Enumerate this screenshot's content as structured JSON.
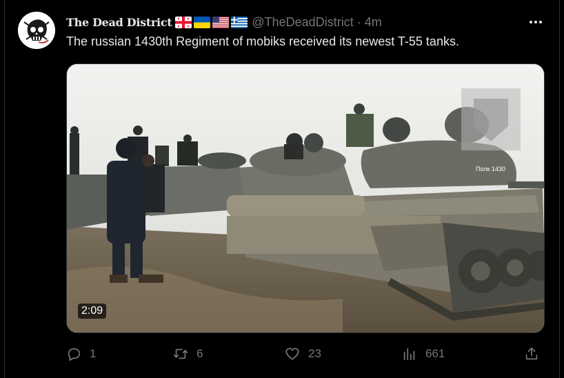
{
  "post": {
    "display_name": "The Dead District",
    "flags": [
      "georgia-flag-icon",
      "ukraine-flag-icon",
      "usa-flag-icon",
      "greece-flag-icon"
    ],
    "handle": "@TheDeadDistrict",
    "separator": "·",
    "time": "4m",
    "text": "The russian 1430th Regiment of mobiks received its newest T-55 tanks.",
    "more_icon": "more-horizontal-icon"
  },
  "media": {
    "duration": "2:09",
    "watermark_text": "Полк 1430"
  },
  "actions": {
    "reply": {
      "icon": "reply-icon",
      "count": "1"
    },
    "repost": {
      "icon": "repost-icon",
      "count": "6"
    },
    "like": {
      "icon": "heart-icon",
      "count": "23"
    },
    "views": {
      "icon": "views-icon",
      "count": "661"
    },
    "share": {
      "icon": "share-icon"
    }
  },
  "colors": {
    "background": "#000000",
    "text_primary": "#e7e9ea",
    "text_secondary": "#71767b",
    "border": "#2f3336"
  }
}
